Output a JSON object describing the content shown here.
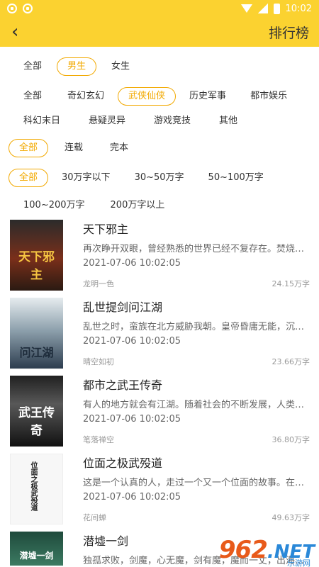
{
  "status": {
    "time": "10:02"
  },
  "header": {
    "title": "排行榜",
    "back_icon": "chevron-left-icon"
  },
  "filters": {
    "gender": [
      "全部",
      "男生",
      "女生"
    ],
    "gender_active": "男生",
    "category": [
      "全部",
      "奇幻玄幻",
      "武侠仙侠",
      "历史军事",
      "都市娱乐",
      "科幻末日",
      "悬疑灵异",
      "游戏竞技",
      "其他"
    ],
    "category_active": "武侠仙侠",
    "status": [
      "全部",
      "连载",
      "完本"
    ],
    "status_active": "全部",
    "words": [
      "全部",
      "30万字以下",
      "30~50万字",
      "50~100万字",
      "100~200万字",
      "200万字以上"
    ],
    "words_active": "全部"
  },
  "books": [
    {
      "title": "天下邪主",
      "desc": "再次睁开双眼，曾经熟悉的世界已经不复存在。焚烧一切...",
      "date": "2021-07-06 10:02:05",
      "author": "龙明一色",
      "words": "24.15万字",
      "cover_text": "天下邪主"
    },
    {
      "title": "乱世提剑问江湖",
      "desc": "乱世之时，蛮族在北方威胁我朝。皇帝昏庸无能，沉迷美...",
      "date": "2021-07-06 10:02:05",
      "author": "晴空如初",
      "words": "23.66万字",
      "cover_text": "问江湖"
    },
    {
      "title": "都市之武王传奇",
      "desc": "有人的地方就会有江湖。随着社会的不断发展，人类武学...",
      "date": "2021-07-06 10:02:05",
      "author": "笔落禅空",
      "words": "36.80万字",
      "cover_text": "武王传奇"
    },
    {
      "title": "位面之极武殁道",
      "desc": "这是一个认真的人，走过一个又一个位面的故事。在《陆...",
      "date": "2021-07-06 10:02:05",
      "author": "花间蝉",
      "words": "49.63万字",
      "cover_text": "位面之极武殁道"
    },
    {
      "title": "潜墟一剑",
      "desc": "独孤求败，剑魔，心无魔，剑有魔，魔而一丈，出海看是...",
      "date": "",
      "author": "",
      "words": "",
      "cover_text": "潜墟一剑"
    }
  ],
  "watermark": {
    "num": "962",
    "net": ".NET",
    "sub": "乐游网"
  },
  "colors": {
    "accent": "#fbd230",
    "active": "#f2a900"
  }
}
